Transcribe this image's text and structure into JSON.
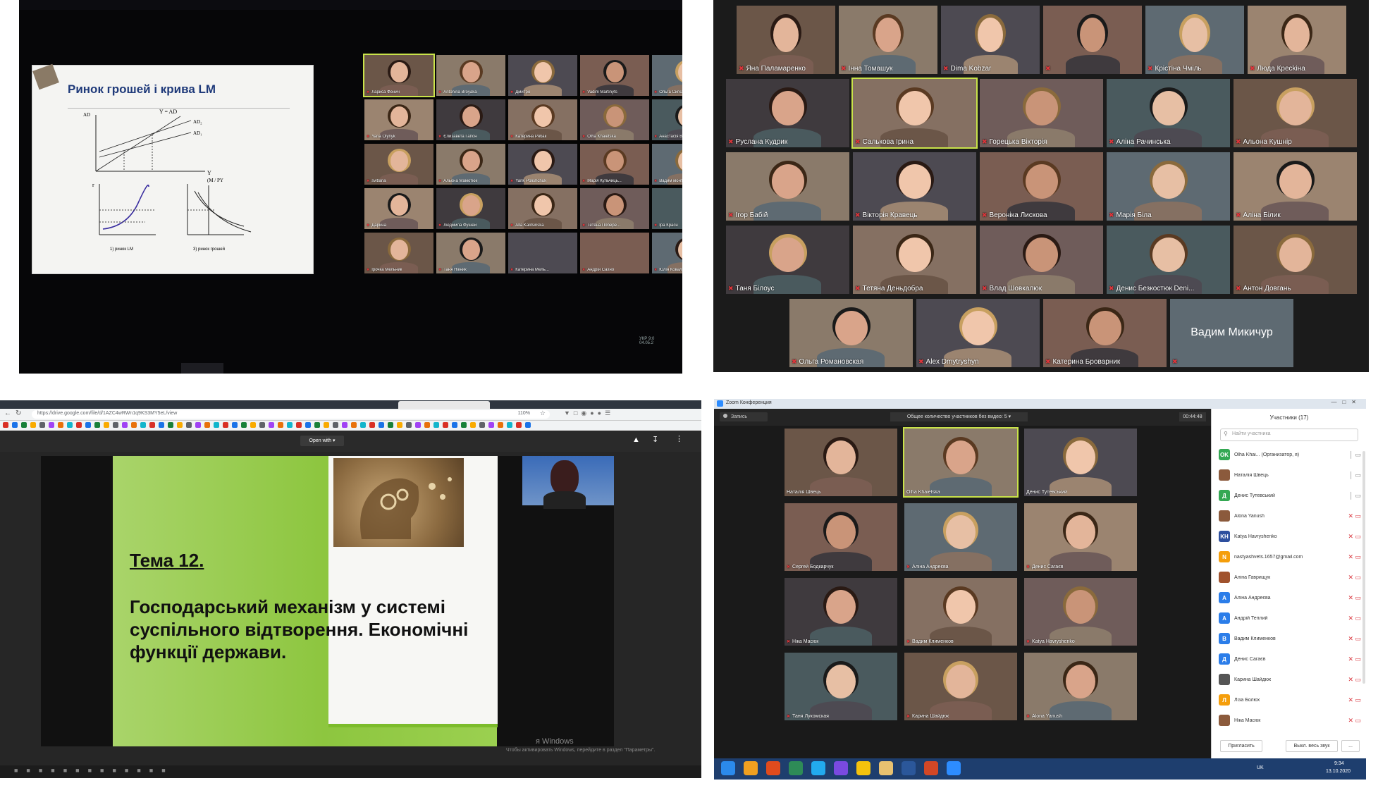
{
  "panel_a": {
    "slide_title": "Ринок грошей і крива LM",
    "graph_labels": {
      "ad": "AD",
      "y_eq_ad": "Y = AD",
      "y": "Y",
      "m_py": "(M / PY",
      "r": "r",
      "lm_label": "1) ринок LM",
      "money_label": "3) ринок грошей",
      "ad1": "AD₁",
      "ad2": "AD₂"
    },
    "tiles": [
      {
        "name": "Лариса Фенич"
      },
      {
        "name": "Antonina Broyaka"
      },
      {
        "name": "Дмитро"
      },
      {
        "name": "Vadim Martinyts"
      },
      {
        "name": "Ольга Сигкан"
      },
      {
        "name": "Yana Olynyk"
      },
      {
        "name": "Єлизавета Гапон"
      },
      {
        "name": "Катерина Рябак"
      },
      {
        "name": "Olha Khaietska"
      },
      {
        "name": "Анастасія Волкова"
      },
      {
        "name": "svitlana"
      },
      {
        "name": "Альона Мамотюк"
      },
      {
        "name": "Yarik Polishchuk"
      },
      {
        "name": "Марія Кульчиць..."
      },
      {
        "name": "Вадим монтора..."
      },
      {
        "name": "Дарина"
      },
      {
        "name": "Людмила Фушей"
      },
      {
        "name": "Alla Kalitsinska"
      },
      {
        "name": "Тетяна Поберe..."
      },
      {
        "name": "Іра Красн"
      },
      {
        "name": "Ірочка Мельник"
      },
      {
        "name": "Таня Нікник"
      },
      {
        "name": "Катерина Мель..."
      },
      {
        "name": "Андрій Сахно"
      },
      {
        "name": "Юлія Ковальськ"
      }
    ],
    "taskbar": {
      "lang": "УКР",
      "time": "9:0",
      "date": "04.05.2"
    }
  },
  "panel_b": {
    "tiles": [
      {
        "name": "Яна Паламаренко"
      },
      {
        "name": "Інна Томашук"
      },
      {
        "name": "Dima Kobzar"
      },
      {
        "name": ""
      },
      {
        "name": "Крістіна Чміль"
      },
      {
        "name": "Люда Кресkіна"
      },
      {
        "name": "Руслана Кудрик"
      },
      {
        "name": "Салькова Ірина"
      },
      {
        "name": "Горецька Вікторія"
      },
      {
        "name": "Аліна Рачинська"
      },
      {
        "name": "Альона Кушнір"
      },
      {
        "name": "Ігор Бабій"
      },
      {
        "name": "Вікторія Кравець"
      },
      {
        "name": "Вероніка Лискова"
      },
      {
        "name": "Марія Біла"
      },
      {
        "name": "Аліна Білик"
      },
      {
        "name": "Таня Білоус"
      },
      {
        "name": "Тетяна Деньдобра"
      },
      {
        "name": "Влад Шовкалюк"
      },
      {
        "name": "Денис Безкостюк Deni..."
      },
      {
        "name": "Антон Довгань"
      },
      {
        "name": "Ольга Романовская"
      },
      {
        "name": "Alex Dmytryshyn"
      },
      {
        "name": "Катерина Броварник"
      },
      {
        "name": "Вадим Микичур"
      }
    ]
  },
  "panel_c": {
    "url": "https://drive.google.com/file/d/1AZC4wRWn1q9KS3MY5eL/view",
    "zoom": "110%",
    "open_with": "Open with",
    "slide_topic": "Тема 12.",
    "slide_text": "Господарський механізм у системі суспільного відтворення. Економічні функції держави.",
    "watermark_1": "я Windows",
    "watermark_2": "Чтобы активировать Windows, перейдите в раздел \"Параметры\"."
  },
  "panel_d": {
    "title": "Zoom Конференция",
    "record": "Запись",
    "banner": "Общее количество участников без видео: 5",
    "timer": "00:44:48",
    "participants_title": "Участники (17)",
    "search_placeholder": "Найти участника",
    "tiles": [
      {
        "name": "Наталія Швець"
      },
      {
        "name": "Olha Khaietska"
      },
      {
        "name": "Денис Тутевський"
      },
      {
        "name": "Сергей Бодкарчук"
      },
      {
        "name": "Аліна Андреєва"
      },
      {
        "name": "Денис Сагаєв"
      },
      {
        "name": "Ніка Масюк"
      },
      {
        "name": "Вадим Клименков"
      },
      {
        "name": "Katya Havryshenko"
      },
      {
        "name": "Таня Лукомская"
      },
      {
        "name": "Карина Шайдюк"
      },
      {
        "name": "Alona Yanush"
      }
    ],
    "participants": [
      {
        "avatar": "OK",
        "name": "Olha Khai... (Организатор, я)",
        "color": "#34a853"
      },
      {
        "avatar": "",
        "name": "Наталія Швець",
        "color": "#8b5a3c"
      },
      {
        "avatar": "Д",
        "name": "Денис Тутевський",
        "color": "#34a853"
      },
      {
        "avatar": "",
        "name": "Alona Yanush",
        "color": "#8b5a3c"
      },
      {
        "avatar": "KH",
        "name": "Katya Havryshenko",
        "color": "#2d4f9e"
      },
      {
        "avatar": "N",
        "name": "nastyashvets.1657@gmail.com",
        "color": "#f59e0b"
      },
      {
        "avatar": "",
        "name": "Аліна Гаврищук",
        "color": "#a0522d"
      },
      {
        "avatar": "A",
        "name": "Аліна Андреєва",
        "color": "#2b7de9"
      },
      {
        "avatar": "A",
        "name": "Андрій Теплий",
        "color": "#2b7de9"
      },
      {
        "avatar": "В",
        "name": "Вадим Клименков",
        "color": "#2b7de9"
      },
      {
        "avatar": "Д",
        "name": "Денис Сагаєв",
        "color": "#2b7de9"
      },
      {
        "avatar": "",
        "name": "Карина Шайдюк",
        "color": "#555555"
      },
      {
        "avatar": "Л",
        "name": "Ліза Болюх",
        "color": "#f59e0b"
      },
      {
        "avatar": "",
        "name": "Ніка Масюк",
        "color": "#8b5a3c"
      }
    ],
    "invite": "Пригласить",
    "mute_all": "Выкл. весь звук",
    "more": "...",
    "taskbar": {
      "lang": "UK",
      "time": "9:34",
      "date": "13.10.2020"
    }
  },
  "colors": {
    "zoom_red": "#e0363b",
    "zoom_active": "#c9e34a",
    "slide_green": "#8dc63f"
  }
}
